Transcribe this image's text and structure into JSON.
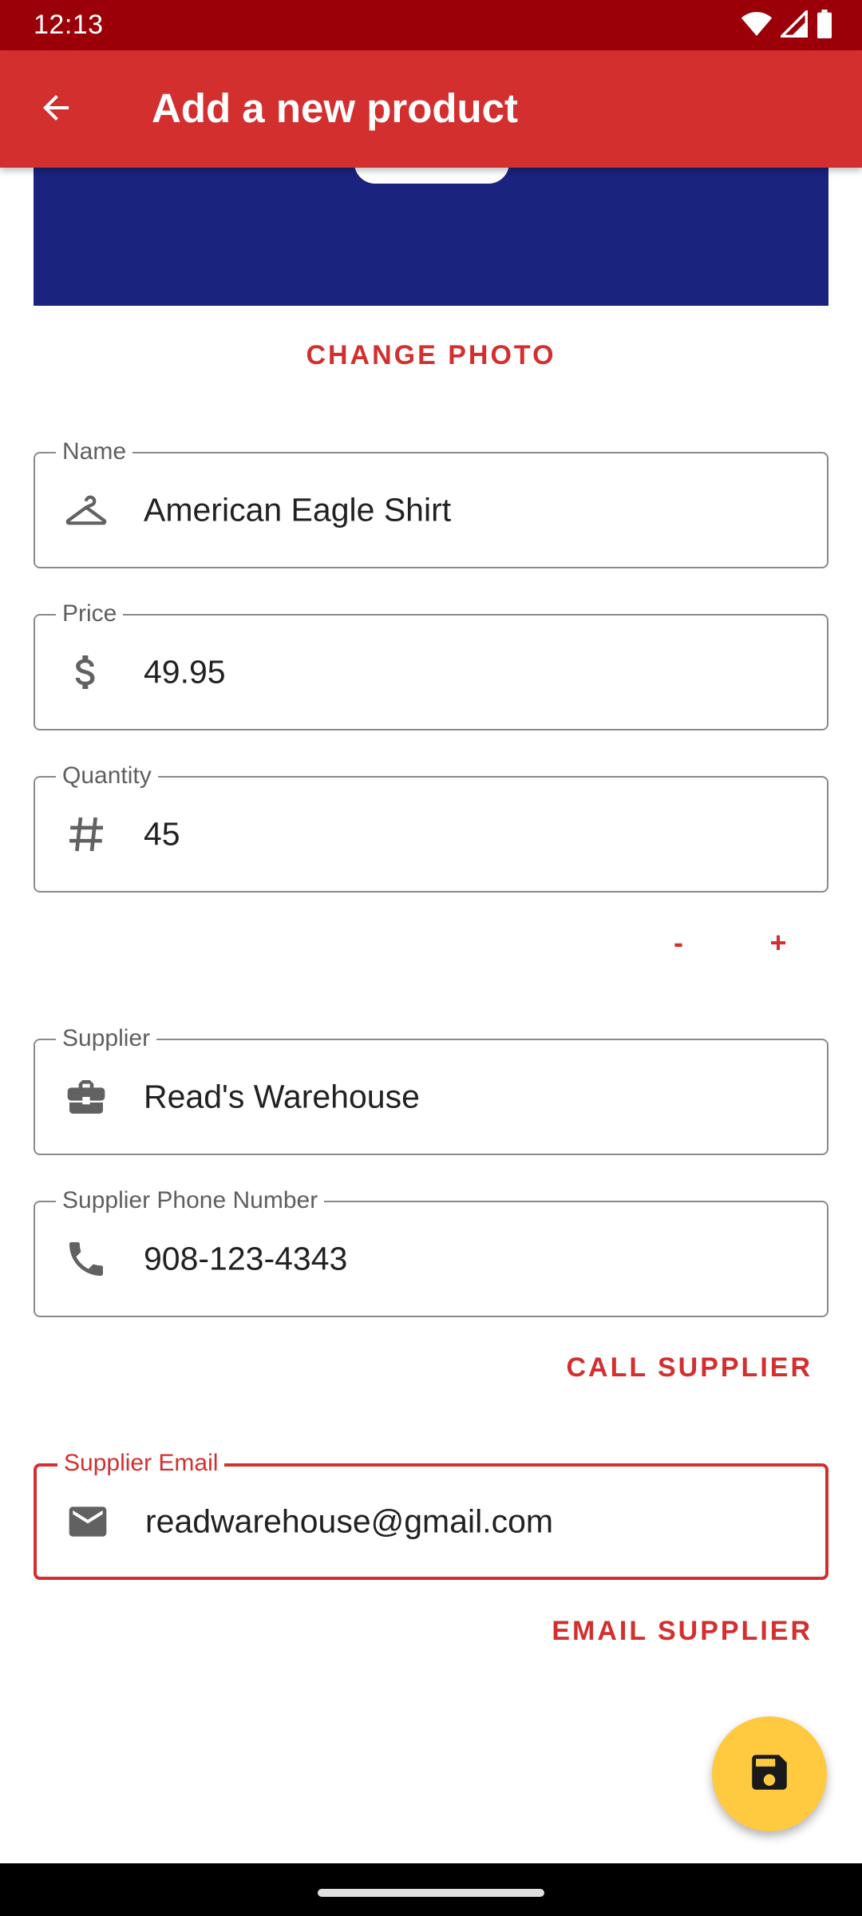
{
  "status_bar": {
    "time": "12:13",
    "icons": [
      "wifi-icon",
      "cell-signal-icon",
      "battery-icon"
    ]
  },
  "app_bar": {
    "title": "Add a new product",
    "back_icon": "arrow-back-icon",
    "color": "#d32f2f"
  },
  "photo": {
    "background_color": "#1a237e",
    "change_label": "CHANGE PHOTO"
  },
  "fields": {
    "name": {
      "label": "Name",
      "value": "American Eagle Shirt",
      "icon": "hanger-icon"
    },
    "price": {
      "label": "Price",
      "value": "49.95",
      "icon": "dollar-icon"
    },
    "quantity": {
      "label": "Quantity",
      "value": "45",
      "icon": "hash-icon"
    },
    "supplier": {
      "label": "Supplier",
      "value": "Read's Warehouse",
      "icon": "briefcase-icon"
    },
    "supplier_phone": {
      "label": "Supplier Phone Number",
      "value": "908-123-4343",
      "icon": "phone-icon"
    },
    "supplier_email": {
      "label": "Supplier Email",
      "value": "readwarehouse@gmail.com",
      "icon": "email-icon",
      "focused": true
    }
  },
  "quantity_stepper": {
    "decrement_label": "-",
    "increment_label": "+"
  },
  "actions": {
    "call_supplier": "CALL SUPPLIER",
    "email_supplier": "EMAIL SUPPLIER"
  },
  "fab": {
    "icon": "save-icon",
    "color": "#ffc940"
  }
}
